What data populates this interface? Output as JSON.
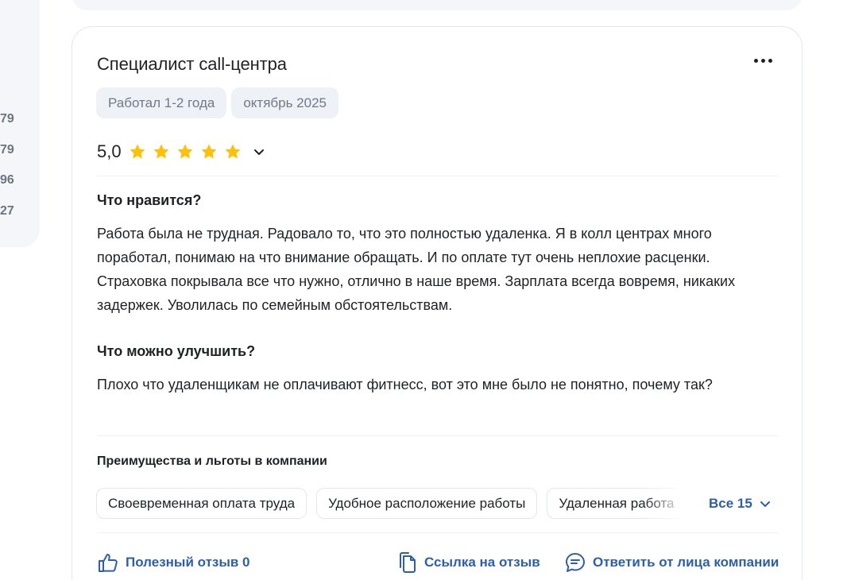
{
  "left_panel": {
    "numbers": [
      "79",
      "79",
      "96",
      "27"
    ]
  },
  "review": {
    "title": "Специалист call-центра",
    "tags": [
      "Работал 1-2 года",
      "октябрь 2025"
    ],
    "rating": "5,0",
    "stars_filled": 5,
    "stars_total": 5,
    "likes_heading": "Что нравится?",
    "likes_text": "Работа была не трудная. Радовало то, что это полностью удаленка. Я в колл центрах много поработал, понимаю на что внимание обращать. И по оплате тут очень неплохие расценки. Страховка покрывала все что нужно, отлично в наше время. Зарплата всегда вовремя, никаких задержек. Уволилась по семейным обстоятельствам.",
    "improve_heading": "Что можно улучшить?",
    "improve_text": "Плохо что удаленщикам не оплачивают фитнесс, вот это мне было не понятно, почему так?",
    "benefits_heading": "Преимущества и льготы в компании",
    "benefits": [
      "Своевременная оплата труда",
      "Удобное расположение работы",
      "Удаленная работа"
    ],
    "benefits_all_label": "Все 15",
    "actions": {
      "helpful": "Полезный отзыв 0",
      "link": "Ссылка на отзыв",
      "reply": "Ответить от лица компании"
    }
  },
  "colors": {
    "accent": "#2c5fa8",
    "star": "#ffc107",
    "chip_bg": "#eef1f6",
    "panel_bg": "#f4f6fa"
  },
  "icons": [
    "more-dots-icon",
    "star-icon",
    "chevron-down-icon",
    "thumbs-up-icon",
    "copy-icon",
    "chat-bubble-icon"
  ]
}
